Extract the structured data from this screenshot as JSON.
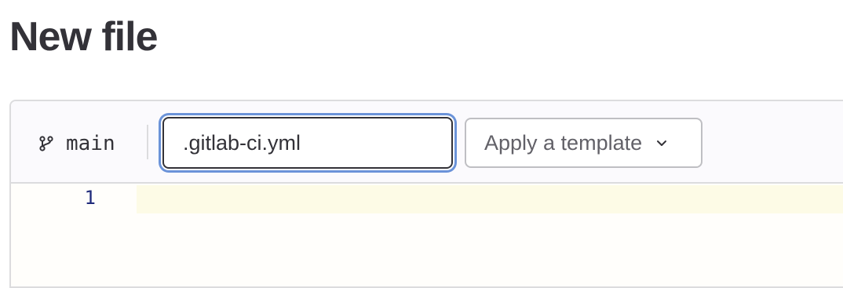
{
  "page": {
    "title": "New file"
  },
  "toolbar": {
    "branch_icon": "branch-icon",
    "branch_name": "main",
    "filename_value": ".gitlab-ci.yml",
    "template_label": "Apply a template",
    "template_chevron_icon": "chevron-down-icon"
  },
  "editor": {
    "line_numbers": [
      "1"
    ],
    "lines": [
      ""
    ]
  },
  "colors": {
    "text": "#333238",
    "focus_ring": "#6b93d9",
    "border": "#dcdcde",
    "active_line": "#fdfbe6",
    "line_number": "#1f2a7a"
  }
}
